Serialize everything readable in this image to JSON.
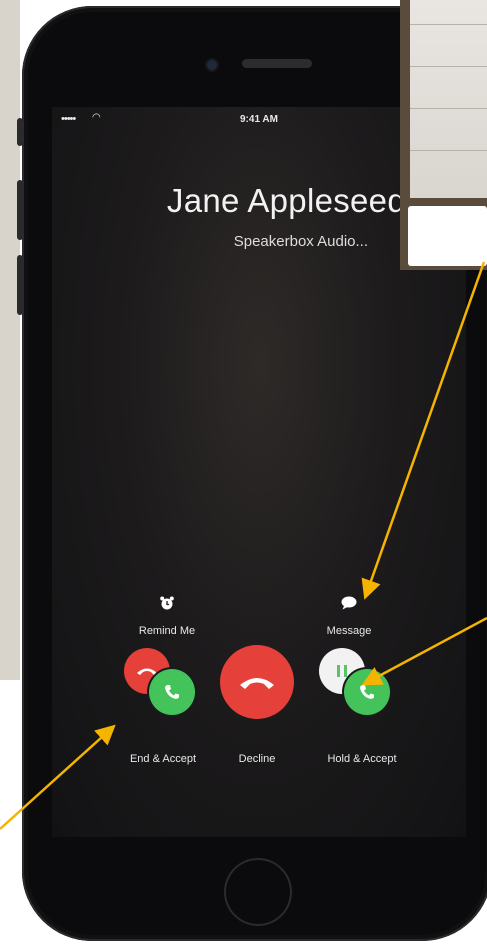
{
  "status_bar": {
    "signal": "•••••",
    "time": "9:41 AM"
  },
  "caller": {
    "name": "Jane Appleseed",
    "subtitle": "Speakerbox Audio..."
  },
  "actions": {
    "remind_me": {
      "label": "Remind Me",
      "icon": "alarm-clock-icon"
    },
    "message": {
      "label": "Message",
      "icon": "speech-bubble-icon"
    }
  },
  "buttons": {
    "end_accept": "End & Accept",
    "decline": "Decline",
    "hold_accept": "Hold & Accept"
  },
  "colors": {
    "decline_red": "#e5413a",
    "accept_green": "#43c35a",
    "annotation_arrow": "#f5b400"
  }
}
